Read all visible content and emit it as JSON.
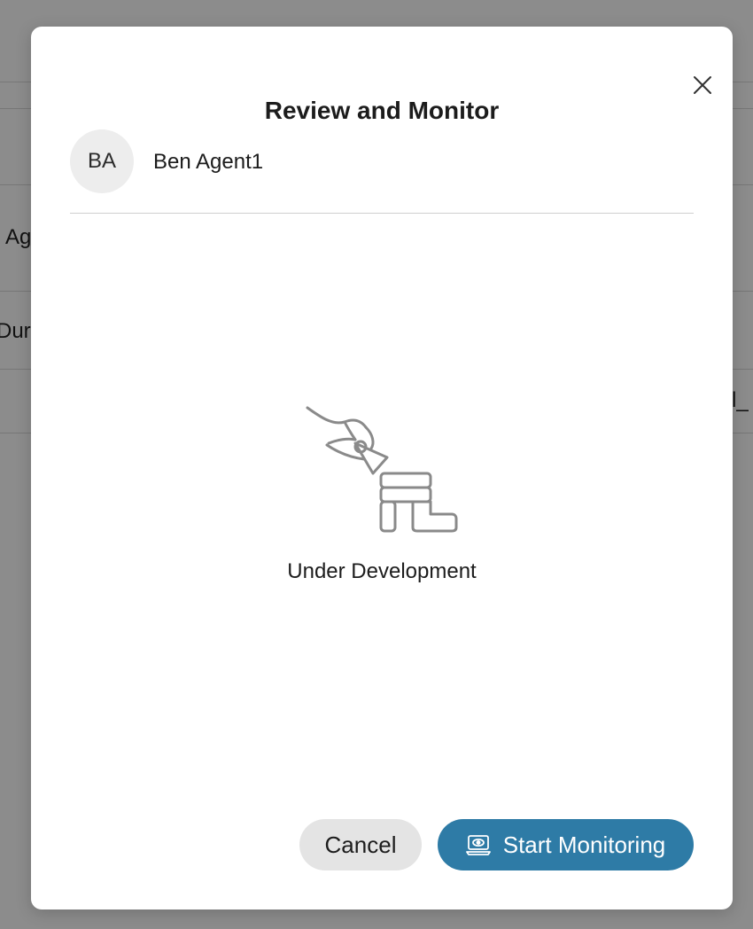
{
  "background": {
    "fragments": [
      "Ag",
      "Dura",
      "l_"
    ]
  },
  "modal": {
    "title": "Review and Monitor",
    "close_icon": "close-icon",
    "agent": {
      "initials": "BA",
      "name": "Ben Agent1"
    },
    "empty_state": {
      "illustration": "under-construction-icon",
      "message": "Under Development"
    },
    "buttons": {
      "cancel_label": "Cancel",
      "start_label": "Start Monitoring",
      "start_icon": "monitor-icon"
    }
  },
  "colors": {
    "primary": "#2e7ba6",
    "secondary_button": "#e4e4e4",
    "avatar_bg": "#ededed"
  }
}
